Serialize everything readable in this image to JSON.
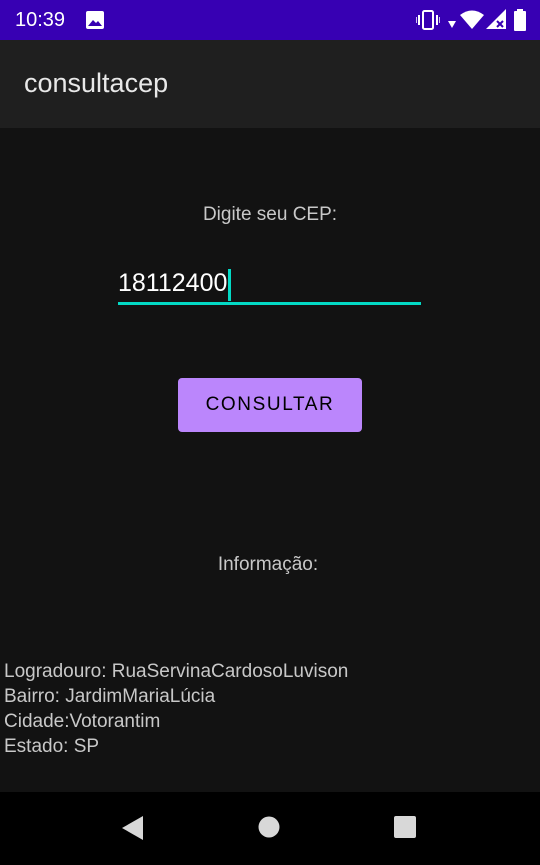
{
  "status_bar": {
    "time": "10:39",
    "background_color": "#3700b3",
    "icons": [
      "image-icon",
      "vibrate-icon",
      "data-arrow-icon",
      "wifi-icon",
      "signal-icon",
      "battery-icon"
    ]
  },
  "app_bar": {
    "title": "consultacep"
  },
  "form": {
    "cep_label": "Digite seu CEP:",
    "cep_value": "18112400",
    "accent_color": "#03dac5",
    "consult_button_label": "CONSULTAR",
    "button_color": "#bb86fc"
  },
  "info": {
    "label": "Informação:",
    "logradouro": "Logradouro: RuaServinaCardosoLuvison",
    "bairro": "Bairro: JardimMariaLúcia",
    "cidade": "Cidade:Votorantim",
    "estado": "Estado: SP"
  },
  "nav_bar": {
    "icons": [
      "back-icon",
      "home-icon",
      "recents-icon"
    ]
  }
}
